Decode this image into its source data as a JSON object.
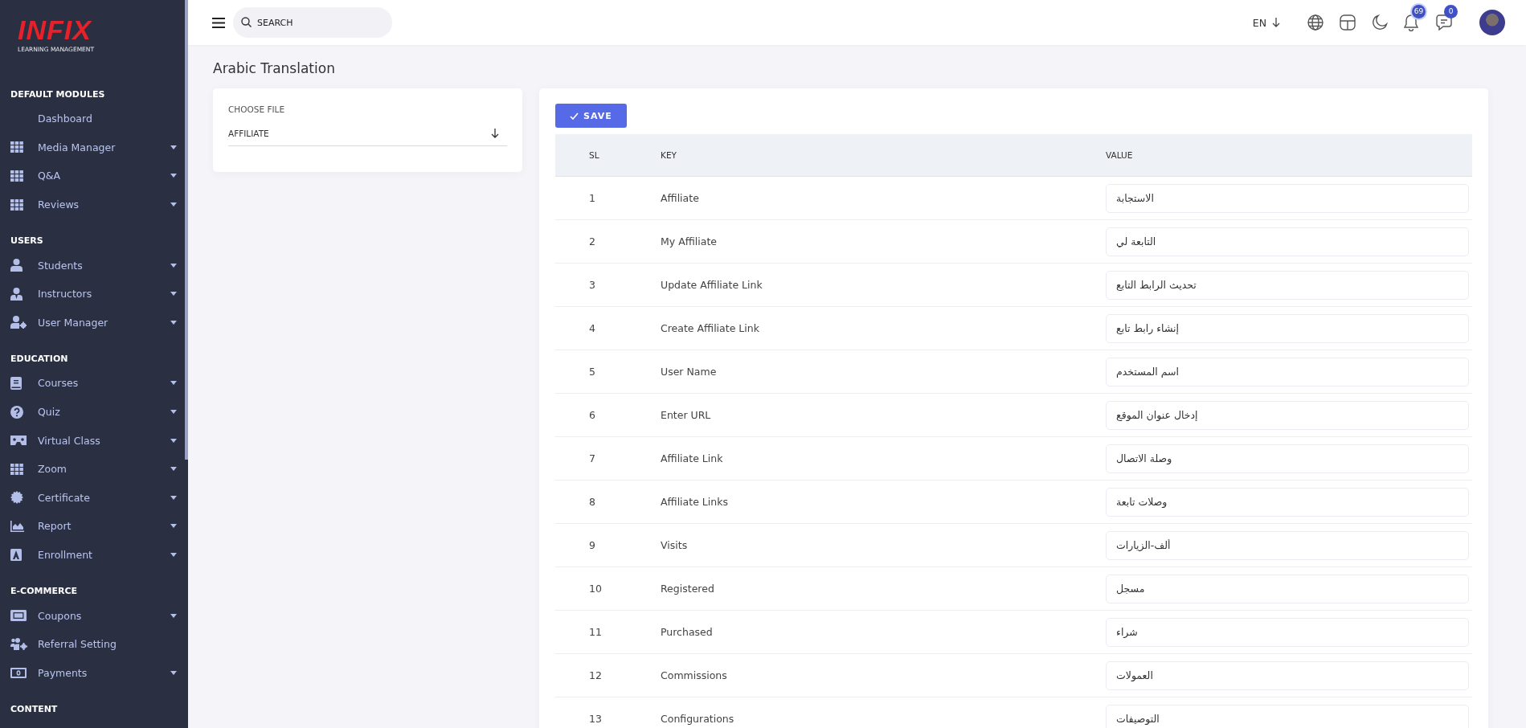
{
  "sidebar": {
    "logo": {
      "title": "INFIX",
      "subtitle": "LEARNING MANAGEMENT"
    },
    "sections": [
      {
        "heading": "DEFAULT MODULES",
        "items": [
          {
            "label": "Dashboard",
            "kind": "plain",
            "has_submenu": false
          },
          {
            "label": "Media Manager",
            "kind": "grid",
            "has_submenu": true
          },
          {
            "label": "Q&A",
            "kind": "grid",
            "has_submenu": true
          },
          {
            "label": "Reviews",
            "kind": "grid",
            "has_submenu": true
          }
        ]
      },
      {
        "heading": "USERS",
        "items": [
          {
            "label": "Students",
            "kind": "user",
            "has_submenu": true
          },
          {
            "label": "Instructors",
            "kind": "tieuser",
            "has_submenu": true
          },
          {
            "label": "User Manager",
            "kind": "usergear",
            "has_submenu": true
          }
        ]
      },
      {
        "heading": "EDUCATION",
        "items": [
          {
            "label": "Courses",
            "kind": "book",
            "has_submenu": true
          },
          {
            "label": "Quiz",
            "kind": "question",
            "has_submenu": true
          },
          {
            "label": "Virtual Class",
            "kind": "vr",
            "has_submenu": true
          },
          {
            "label": "Zoom",
            "kind": "grid",
            "has_submenu": true
          },
          {
            "label": "Certificate",
            "kind": "seal",
            "has_submenu": true
          },
          {
            "label": "Report",
            "kind": "chart",
            "has_submenu": true
          },
          {
            "label": "Enrollment",
            "kind": "abox",
            "has_submenu": true
          }
        ]
      },
      {
        "heading": "E-COMMERCE",
        "items": [
          {
            "label": "Coupons",
            "kind": "ticket",
            "has_submenu": true
          },
          {
            "label": "Referral Setting",
            "kind": "usersgear",
            "has_submenu": false
          },
          {
            "label": "Payments",
            "kind": "money",
            "has_submenu": true
          }
        ]
      },
      {
        "heading": "CONTENT"
      }
    ]
  },
  "topbar": {
    "search": {
      "placeholder": "SEARCH"
    },
    "language": "EN",
    "notifications": "69",
    "messages": "0"
  },
  "page_title": "Arabic Translation",
  "file_chooser": {
    "label": "CHOOSE FILE",
    "value": "AFFILIATE"
  },
  "save_button": "SAVE",
  "table": {
    "columns": [
      "SL",
      "KEY",
      "VALUE"
    ],
    "rows": [
      {
        "sl": "1",
        "key": "Affiliate",
        "value": "الاستجابة"
      },
      {
        "sl": "2",
        "key": "My Affiliate",
        "value": "التابعة لي"
      },
      {
        "sl": "3",
        "key": "Update Affiliate Link",
        "value": "تحديث الرابط التابع"
      },
      {
        "sl": "4",
        "key": "Create Affiliate Link",
        "value": "إنشاء رابط تابع"
      },
      {
        "sl": "5",
        "key": "User Name",
        "value": "اسم المستخدم"
      },
      {
        "sl": "6",
        "key": "Enter URL",
        "value": "إدخال عنوان الموقع"
      },
      {
        "sl": "7",
        "key": "Affiliate Link",
        "value": "وصلة الاتصال"
      },
      {
        "sl": "8",
        "key": "Affiliate Links",
        "value": "وصلات تابعة"
      },
      {
        "sl": "9",
        "key": "Visits",
        "value": "ألف-الزيارات"
      },
      {
        "sl": "10",
        "key": "Registered",
        "value": "مسجل"
      },
      {
        "sl": "11",
        "key": "Purchased",
        "value": "شراء"
      },
      {
        "sl": "12",
        "key": "Commissions",
        "value": "العمولات"
      },
      {
        "sl": "13",
        "key": "Configurations",
        "value": "التوصيفات"
      }
    ]
  }
}
